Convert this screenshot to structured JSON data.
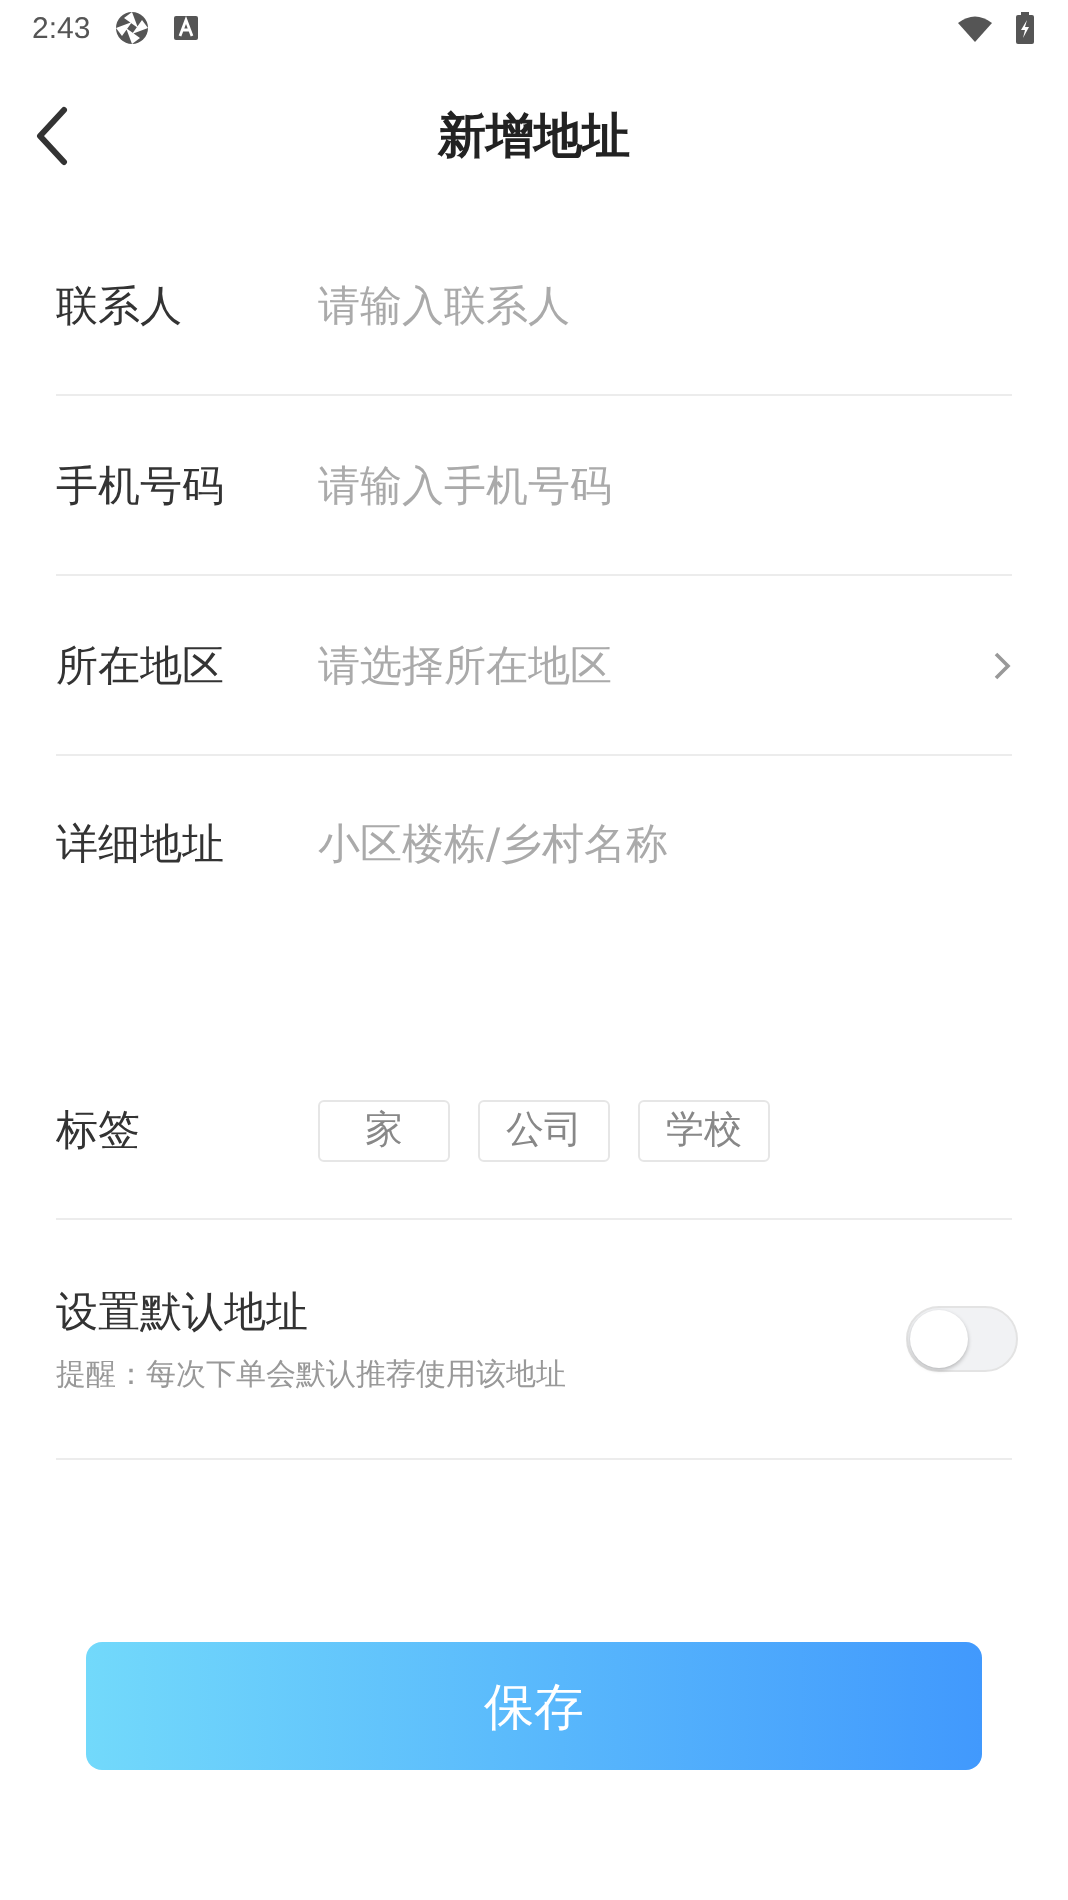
{
  "status_bar": {
    "time": "2:43"
  },
  "header": {
    "title": "新增地址"
  },
  "fields": [
    {
      "kind": "input",
      "label": "联系人",
      "placeholder": "请输入联系人"
    },
    {
      "kind": "input",
      "label": "手机号码",
      "placeholder": "请输入手机号码"
    },
    {
      "kind": "select",
      "label": "所在地区",
      "placeholder": "请选择所在地区"
    },
    {
      "kind": "textarea",
      "label": "详细地址",
      "placeholder": "小区楼栋/乡村名称"
    }
  ],
  "tags": {
    "label": "标签",
    "items": [
      {
        "label": "家",
        "selected": false
      },
      {
        "label": "公司",
        "selected": false
      },
      {
        "label": "学校",
        "selected": false
      }
    ]
  },
  "default_address": {
    "title": "设置默认地址",
    "hint": "提醒：每次下单会默认推荐使用该地址",
    "on": false
  },
  "save_button": "保存"
}
